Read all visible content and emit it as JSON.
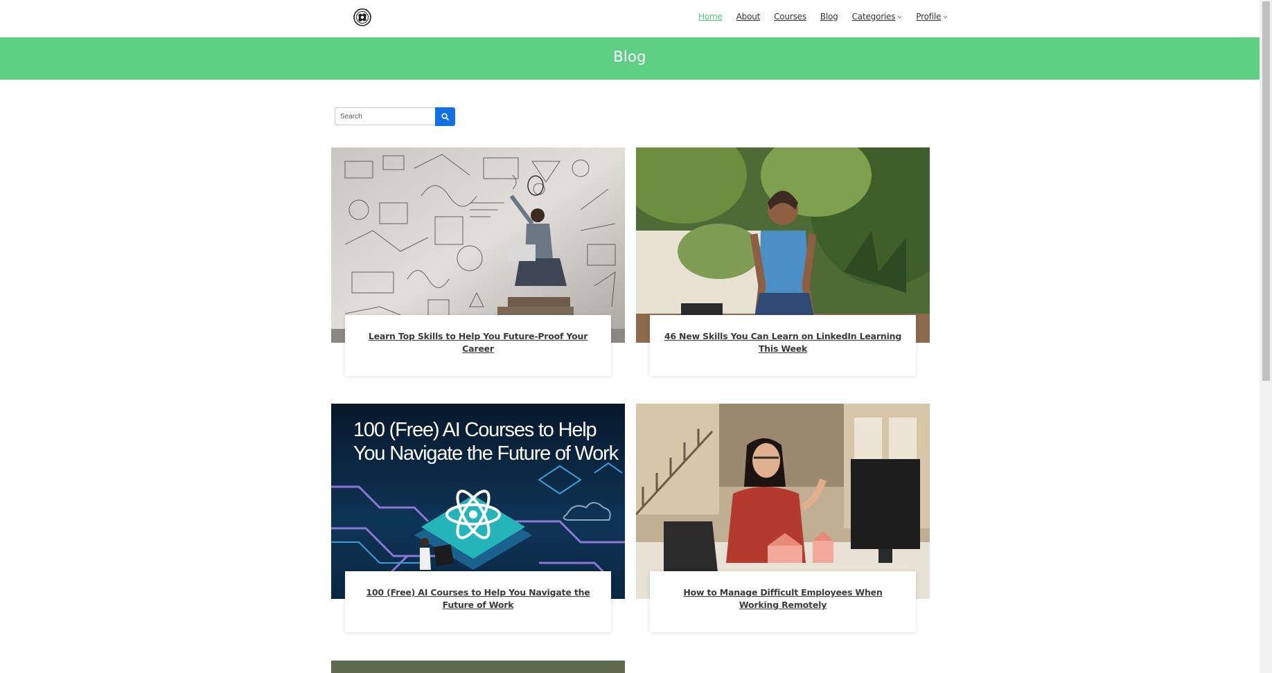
{
  "nav": {
    "items": [
      {
        "label": "Home",
        "active": true
      },
      {
        "label": "About"
      },
      {
        "label": "Courses"
      },
      {
        "label": "Blog"
      },
      {
        "label": "Categories",
        "dropdown": true
      },
      {
        "label": "Profile",
        "dropdown": true
      }
    ]
  },
  "banner": {
    "title": "Blog"
  },
  "search": {
    "placeholder": "Search",
    "button_icon": "search-icon"
  },
  "posts": [
    {
      "title": "Learn Top Skills to Help You Future-Proof Your Career",
      "image": "person-with-laptop-on-books-image"
    },
    {
      "title": "46 New Skills You Can Learn on LinkedIn Learning This Week",
      "image": "woman-in-garden-image"
    },
    {
      "title": "100 (Free) AI Courses to Help You Navigate the Future of Work",
      "image": "ai-courses-graphic-image",
      "image_text": "100 (Free) AI Courses to Help You Navigate the Future of Work"
    },
    {
      "title": "How to Manage Difficult Employees When Working Remotely",
      "image": "woman-at-desk-image"
    }
  ],
  "colors": {
    "accent": "#5fd083",
    "nav_active": "#55c77a",
    "search_button": "#1170e3"
  }
}
